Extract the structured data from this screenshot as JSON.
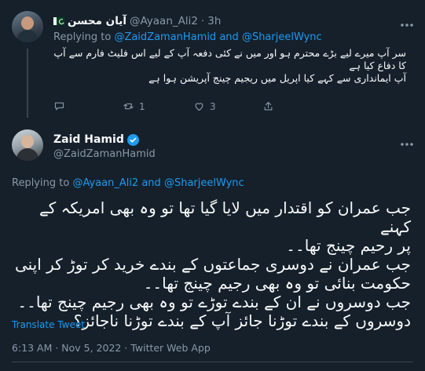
{
  "reply": {
    "name": "آیان محسن",
    "handle": "@Ayaan_Ali2",
    "separator": "·",
    "time": "3h",
    "replying_prefix": "Replying to",
    "replying_users": [
      "@ZaidZamanHamid",
      "@SharjeelWync"
    ],
    "replying_and": "and",
    "text_lines": [
      "سر آپ میرے لیے بڑے محترم ہو اور میں نے کئی دفعہ آپ کے لیے اس فلیٹ فارم سے آپ",
      "کا دفاع کیا ہے",
      "آپ ایمانداری سے کہے کیا اپریل میں ریجیم چینج آپریشن ہوا ہے"
    ],
    "actions": {
      "reply_count": "",
      "retweet_count": "1",
      "like_count": "3"
    }
  },
  "tweet": {
    "name": "Zaid Hamid",
    "handle": "@ZaidZamanHamid",
    "replying_prefix": "Replying to",
    "replying_users": [
      "@Ayaan_Ali2",
      "@SharjeelWync"
    ],
    "replying_and": "and",
    "text_lines": [
      "جب عمران کو اقتدار میں لایا گیا تھا تو وہ بھی امریکہ کے کہنے",
      "پر رحیم چینج تھا۔۔",
      "جب عمران نے دوسری جماعتوں کے بندے خرید کر توڑ کر اپنی",
      "حکومت بنائی تو وہ بھی رجیم چینج تھا۔۔",
      "جب دوسروں نے ان کے بندے توڑے تو وہ بھی رجیم چینج تھا۔۔",
      "دوسروں کے بندے توڑنا جائز آپ کے بندے توڑنا ناجائز؟"
    ],
    "translate_label": "Translate Tweet",
    "timestamp": "6:13 AM · Nov 5, 2022 · Twitter Web App"
  },
  "colors": {
    "background": "#15202b",
    "text": "#f7f9f9",
    "muted": "#8b98a5",
    "accent": "#1d9bf0",
    "border": "#38444d"
  },
  "icons": [
    "pakistan-flag-icon",
    "more-icon",
    "reply-icon",
    "retweet-icon",
    "like-icon",
    "share-icon",
    "verified-badge-icon"
  ]
}
